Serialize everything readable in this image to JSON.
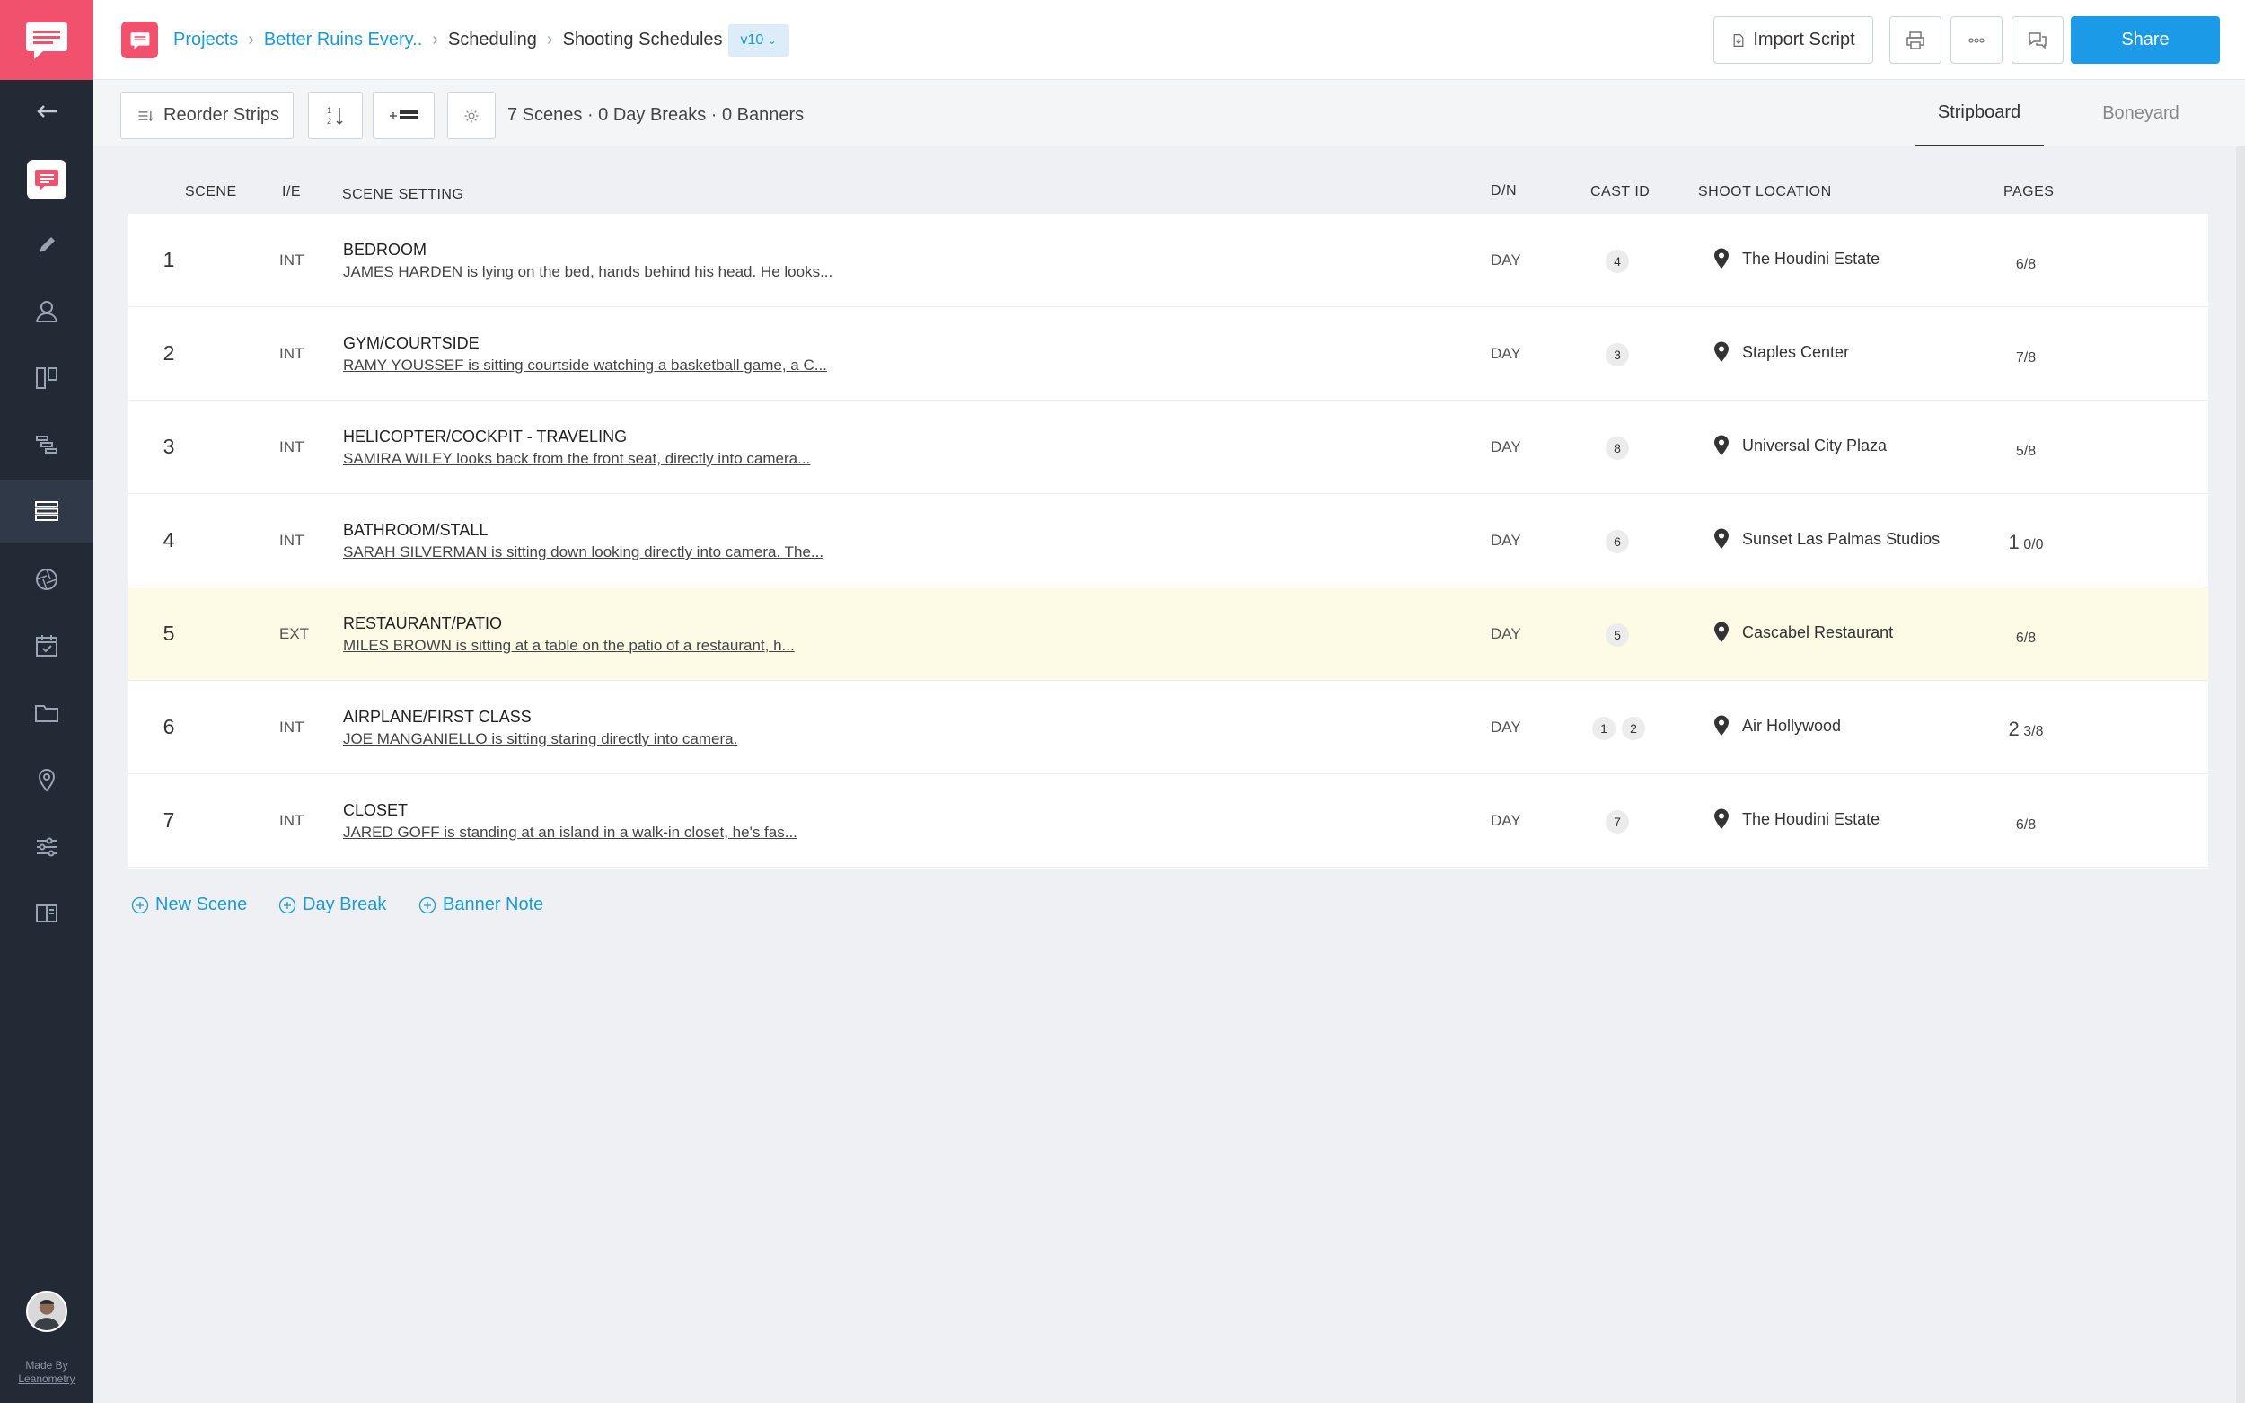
{
  "header": {
    "breadcrumb": [
      "Projects",
      "Better Ruins Every..",
      "Scheduling",
      "Shooting Schedules"
    ],
    "version": "v10",
    "import_label": "Import Script",
    "share_label": "Share"
  },
  "toolbar": {
    "reorder_label": "Reorder Strips",
    "summary": "7 Scenes · 0 Day Breaks · 0 Banners",
    "tabs": [
      "Stripboard",
      "Boneyard"
    ],
    "active_tab": "Stripboard"
  },
  "table": {
    "columns": [
      "Scene",
      "I/E",
      "Scene Setting",
      "D/N",
      "Cast ID",
      "Shoot Location",
      "Pages"
    ],
    "rows": [
      {
        "scene": "1",
        "ie": "INT",
        "title": "BEDROOM",
        "desc": "JAMES HARDEN is lying on the bed, hands behind his head. He looks...",
        "dn": "DAY",
        "cast": [
          "4"
        ],
        "location": "The Houdini Estate",
        "pages_whole": "",
        "pages_frac": "6/8"
      },
      {
        "scene": "2",
        "ie": "INT",
        "title": "GYM/COURTSIDE",
        "desc": "RAMY YOUSSEF is sitting courtside watching a basketball game, a C...",
        "dn": "DAY",
        "cast": [
          "3"
        ],
        "location": "Staples Center",
        "pages_whole": "",
        "pages_frac": "7/8"
      },
      {
        "scene": "3",
        "ie": "INT",
        "title": "HELICOPTER/COCKPIT - TRAVELING",
        "desc": "SAMIRA WILEY looks back from the front seat, directly into camera...",
        "dn": "DAY",
        "cast": [
          "8"
        ],
        "location": "Universal City Plaza",
        "pages_whole": "",
        "pages_frac": "5/8"
      },
      {
        "scene": "4",
        "ie": "INT",
        "title": "BATHROOM/STALL",
        "desc": "SARAH SILVERMAN is sitting down looking directly into camera. The...",
        "dn": "DAY",
        "cast": [
          "6"
        ],
        "location": "Sunset Las Palmas Studios",
        "pages_whole": "1",
        "pages_frac": "0/0"
      },
      {
        "scene": "5",
        "ie": "EXT",
        "title": "RESTAURANT/PATIO",
        "desc": "MILES BROWN is sitting at a table on the patio of a restaurant, h...",
        "dn": "DAY",
        "cast": [
          "5"
        ],
        "location": "Cascabel Restaurant",
        "pages_whole": "",
        "pages_frac": "6/8"
      },
      {
        "scene": "6",
        "ie": "INT",
        "title": "AIRPLANE/FIRST CLASS",
        "desc": "JOE MANGANIELLO is sitting staring directly into camera.",
        "dn": "DAY",
        "cast": [
          "1",
          "2"
        ],
        "location": "Air Hollywood",
        "pages_whole": "2",
        "pages_frac": "3/8"
      },
      {
        "scene": "7",
        "ie": "INT",
        "title": "CLOSET",
        "desc": "JARED GOFF is standing at an island in a walk-in closet, he's fas...",
        "dn": "DAY",
        "cast": [
          "7"
        ],
        "location": "The Houdini Estate",
        "pages_whole": "",
        "pages_frac": "6/8"
      }
    ]
  },
  "actions": {
    "new_scene": "New Scene",
    "day_break": "Day Break",
    "banner_note": "Banner Note"
  },
  "footer": {
    "made_by": "Made By",
    "company": "Leanometry"
  },
  "colors": {
    "brand": "#f2516e",
    "accent": "#1b9ae8",
    "sidebar": "#222a36",
    "highlight_row": "#fdfbe6"
  }
}
